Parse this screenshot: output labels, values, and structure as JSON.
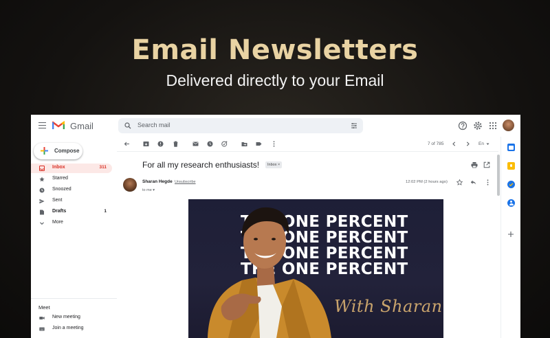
{
  "hero": {
    "title": "Email Newsletters",
    "subtitle": "Delivered directly to your Email"
  },
  "app": {
    "name": "Gmail",
    "search_placeholder": "Search mail"
  },
  "sidebar": {
    "compose_label": "Compose",
    "items": [
      {
        "label": "Inbox",
        "count": "311",
        "icon": "inbox-icon",
        "active": true
      },
      {
        "label": "Starred",
        "count": "",
        "icon": "star-icon"
      },
      {
        "label": "Snoozed",
        "count": "",
        "icon": "clock-icon"
      },
      {
        "label": "Sent",
        "count": "",
        "icon": "send-icon"
      },
      {
        "label": "Drafts",
        "count": "1",
        "icon": "draft-icon"
      },
      {
        "label": "More",
        "count": "",
        "icon": "chevron-down-icon"
      }
    ],
    "meet": {
      "title": "Meet",
      "items": [
        {
          "label": "New meeting",
          "icon": "video-icon"
        },
        {
          "label": "Join a meeting",
          "icon": "keyboard-icon"
        }
      ]
    }
  },
  "toolbar": {
    "pagination": "7 of 785",
    "language": "En"
  },
  "message": {
    "subject": "For all my research enthusiasts!",
    "label_chip": "Inbox ×",
    "sender": "Sharan Hegde",
    "unsubscribe": "Unsubscribe",
    "to": "to me ▾",
    "time": "12:02 PM (2 hours ago)",
    "banner": {
      "line": "THE ONE PERCENT",
      "signature": "With Sharan"
    }
  },
  "colors": {
    "accent_gold": "#e9d3a3",
    "inbox_red": "#d93025",
    "banner_bg": "#1e1f37"
  }
}
